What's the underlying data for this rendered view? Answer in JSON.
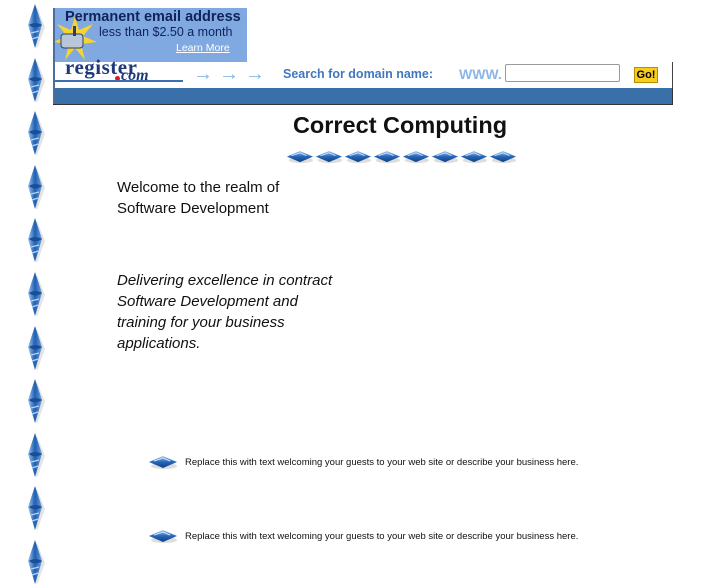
{
  "ad_banner": {
    "title": "Permanent email address",
    "subtitle": "less than $2.50 a month",
    "link_label": "Learn More"
  },
  "register_bar": {
    "logo_text": "register",
    "logo_suffix": "com",
    "arrows": "→→→",
    "search_label": "Search for domain name:",
    "www_prefix": "WWW.",
    "domain_input_value": "",
    "go_label": "Go!"
  },
  "colors": {
    "banner_blue": "#3a70aa",
    "ad_blue": "#7fa9e0",
    "go_yellow": "#f7cc1a",
    "gem_blue": "#2a6cc0"
  },
  "main": {
    "title": "Correct Computing",
    "welcome_lines": [
      "Welcome to the realm of",
      "Software Development"
    ],
    "tagline_lines": [
      "Delivering excellence in contract",
      "Software Development and",
      "training for your business",
      "applications."
    ],
    "bullets": [
      {
        "icon": "blue-gem-icon",
        "text": "Replace this with text welcoming your guests to your web site or describe your business here."
      },
      {
        "icon": "blue-gem-icon",
        "text": "Replace this with text welcoming your guests to your web site or describe your business here."
      }
    ]
  },
  "decor": {
    "left_border_icon": "vertical-gem-icon",
    "divider_icon": "horizontal-gem-icon"
  }
}
